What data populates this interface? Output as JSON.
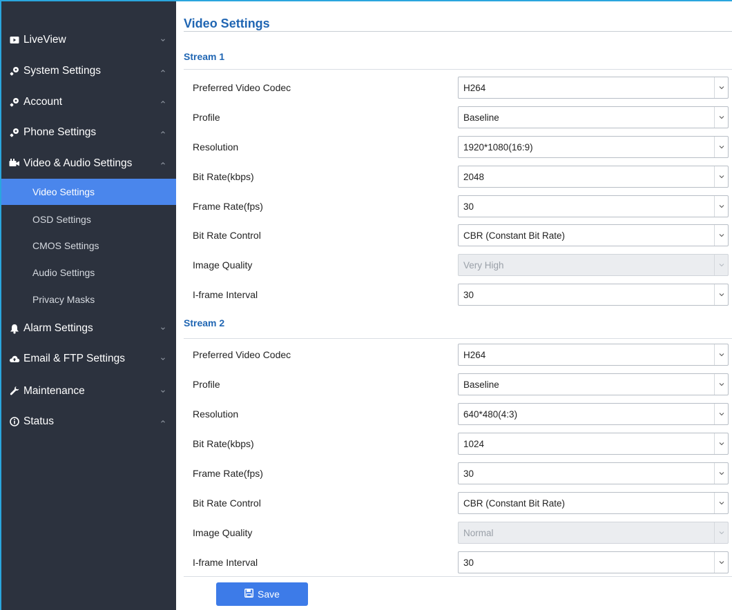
{
  "sidebar": {
    "items": [
      {
        "label": "LiveView",
        "icon": "video-icon",
        "caret": "down"
      },
      {
        "label": "System Settings",
        "icon": "wrench-key-icon",
        "caret": "up"
      },
      {
        "label": "Account",
        "icon": "wrench-key-icon",
        "caret": "up"
      },
      {
        "label": "Phone Settings",
        "icon": "wrench-key-icon",
        "caret": "up"
      },
      {
        "label": "Video & Audio Settings",
        "icon": "media-icon",
        "caret": "up"
      },
      {
        "label": "Alarm Settings",
        "icon": "bell-icon",
        "caret": "down"
      },
      {
        "label": "Email & FTP Settings",
        "icon": "cloud-icon",
        "caret": "down"
      },
      {
        "label": "Maintenance",
        "icon": "wrench-icon",
        "caret": "down"
      },
      {
        "label": "Status",
        "icon": "info-icon",
        "caret": "up"
      }
    ],
    "subitems": [
      {
        "label": "Video Settings",
        "active": true
      },
      {
        "label": "OSD Settings",
        "active": false
      },
      {
        "label": "CMOS Settings",
        "active": false
      },
      {
        "label": "Audio Settings",
        "active": false
      },
      {
        "label": "Privacy Masks",
        "active": false
      }
    ]
  },
  "main": {
    "title": "Video Settings",
    "streams": [
      {
        "title": "Stream 1",
        "fields": [
          {
            "label": "Preferred Video Codec",
            "value": "H264",
            "disabled": false
          },
          {
            "label": "Profile",
            "value": "Baseline",
            "disabled": false
          },
          {
            "label": "Resolution",
            "value": "1920*1080(16:9)",
            "disabled": false
          },
          {
            "label": "Bit Rate(kbps)",
            "value": "2048",
            "disabled": false
          },
          {
            "label": "Frame Rate(fps)",
            "value": "30",
            "disabled": false
          },
          {
            "label": "Bit Rate Control",
            "value": "CBR (Constant Bit Rate)",
            "disabled": false
          },
          {
            "label": "Image Quality",
            "value": "Very High",
            "disabled": true
          },
          {
            "label": "I-frame Interval",
            "value": "30",
            "disabled": false
          }
        ]
      },
      {
        "title": "Stream 2",
        "fields": [
          {
            "label": "Preferred Video Codec",
            "value": "H264",
            "disabled": false
          },
          {
            "label": "Profile",
            "value": "Baseline",
            "disabled": false
          },
          {
            "label": "Resolution",
            "value": "640*480(4:3)",
            "disabled": false
          },
          {
            "label": "Bit Rate(kbps)",
            "value": "1024",
            "disabled": false
          },
          {
            "label": "Frame Rate(fps)",
            "value": "30",
            "disabled": false
          },
          {
            "label": "Bit Rate Control",
            "value": "CBR (Constant Bit Rate)",
            "disabled": false
          },
          {
            "label": "Image Quality",
            "value": "Normal",
            "disabled": true
          },
          {
            "label": "I-frame Interval",
            "value": "30",
            "disabled": false
          }
        ]
      }
    ],
    "save_label": "Save"
  },
  "colors": {
    "sidebar_bg": "#2c323e",
    "active_item": "#4a86ec",
    "title_blue": "#2066b3",
    "button_blue": "#3d7be8",
    "frame_accent": "#2aa6de"
  }
}
